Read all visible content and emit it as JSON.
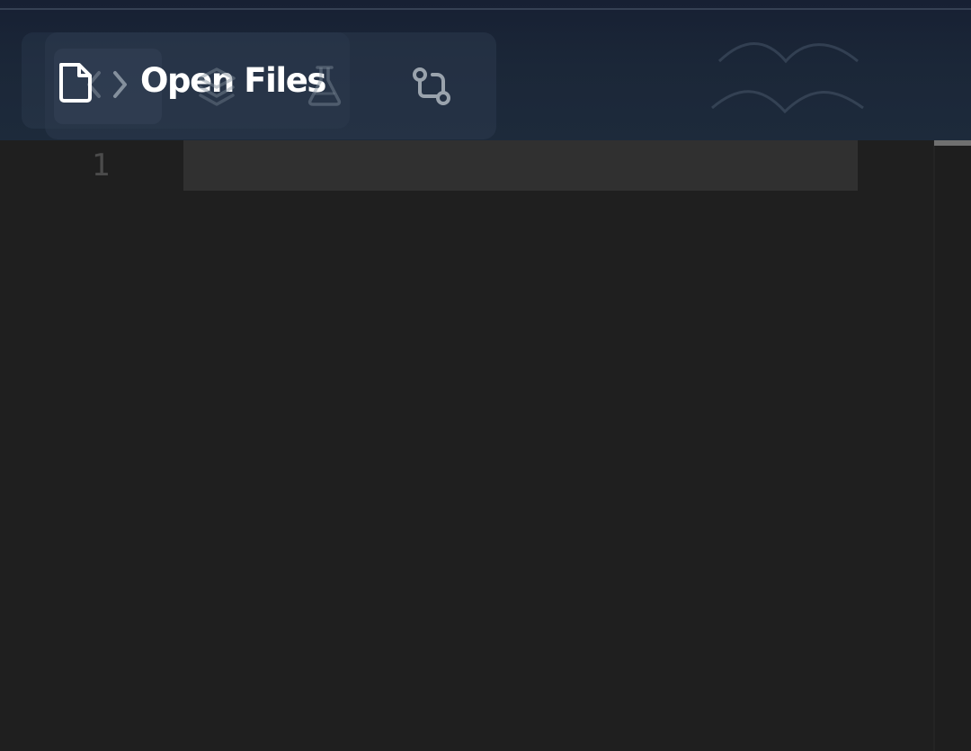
{
  "header": {
    "title": "Open Files"
  },
  "icons": {
    "file": "file-icon",
    "code": "code-icon",
    "layers": "layers-icon",
    "flask": "flask-icon",
    "branch": "branch-icon"
  },
  "editor": {
    "line_numbers": [
      "1"
    ]
  },
  "colors": {
    "header_background": "#1b2738",
    "editor_background": "#1f1f1f",
    "current_line": "#303030",
    "foreground": "#ffffff",
    "muted_icon": "#9aa3ad",
    "line_number": "#4b4b4b"
  }
}
